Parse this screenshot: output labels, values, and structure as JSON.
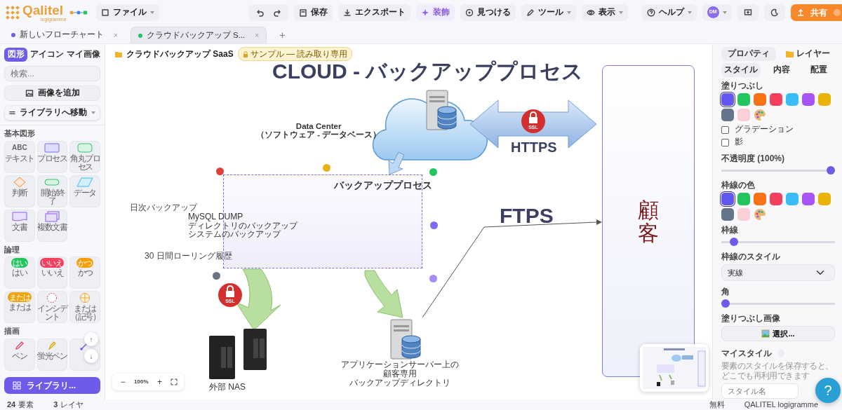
{
  "header": {
    "logo": "Qalitel",
    "logo_sub": "logigramme",
    "file_menu": "ファイル",
    "actions": [
      {
        "label": "保存",
        "active": false,
        "dropdown": false
      },
      {
        "label": "エクスポート",
        "active": false,
        "dropdown": false
      },
      {
        "label": "装飾",
        "active": true,
        "dropdown": false
      },
      {
        "label": "見つける",
        "active": false,
        "dropdown": false
      },
      {
        "label": "ツール",
        "active": false,
        "dropdown": true
      },
      {
        "label": "表示",
        "active": false,
        "dropdown": true
      },
      {
        "label": "ヘルプ",
        "active": false,
        "dropdown": true
      }
    ],
    "avatar": "DM",
    "share": "共有"
  },
  "tabs": [
    {
      "label": "新しいフローチャート",
      "color": "#6c5ce7",
      "selected": false,
      "close": "×"
    },
    {
      "label": "クラウドバックアップ S...",
      "color": "#22c55e",
      "selected": true,
      "close": "×"
    }
  ],
  "new_tab": "+",
  "library": {
    "tabs": [
      {
        "label": "図形",
        "selected": true
      },
      {
        "label": "アイコン",
        "selected": false
      },
      {
        "label": "マイ画像",
        "selected": false
      }
    ],
    "search_placeholder": "検索...",
    "add_image": "画像を追加",
    "goto_library": "ライブラリへ移動",
    "sections": [
      {
        "title": "基本図形",
        "items": [
          {
            "kind": "text",
            "glyph": "ABC",
            "label": "テキスト"
          },
          {
            "kind": "process",
            "label": "プロセス"
          },
          {
            "kind": "rounded",
            "label": "角丸プロセス"
          },
          {
            "kind": "decision",
            "label": "判断"
          },
          {
            "kind": "terminal",
            "label": "開始/終了"
          },
          {
            "kind": "data",
            "label": "データ"
          },
          {
            "kind": "document",
            "label": "文書"
          },
          {
            "kind": "multidoc",
            "label": "複数文書"
          }
        ]
      },
      {
        "title": "論理",
        "items": [
          {
            "kind": "pill",
            "color": "#22c55e",
            "badge": "はい",
            "label": "はい"
          },
          {
            "kind": "pill",
            "color": "#f43f5e",
            "badge": "いいえ",
            "label": "いいえ"
          },
          {
            "kind": "pill",
            "color": "#f59e0b",
            "badge": "かつ",
            "label": "かつ"
          },
          {
            "kind": "pill",
            "color": "#f0a30a",
            "badge": "または",
            "label": "または"
          },
          {
            "kind": "dashed",
            "label": "インシデント"
          },
          {
            "kind": "cross",
            "label": "または（記号）"
          }
        ]
      },
      {
        "title": "描画",
        "items": [
          {
            "kind": "pen",
            "label": "ペン"
          },
          {
            "kind": "highlighter",
            "label": "蛍光ペン"
          },
          {
            "kind": "line"
          }
        ]
      }
    ],
    "scroll": [
      "↑",
      "↓"
    ],
    "library_button": "ライブラリ..."
  },
  "diagram": {
    "breadcrumb": "クラウドバックアップ SaaS",
    "badge": "サンプル — 読み取り専用",
    "title": "CLOUD - バックアッププロセス",
    "data_center": [
      "Data Center",
      "（ソフトウェア - データベース）"
    ],
    "https": "HTTPS",
    "ssl": [
      "SSL",
      "SSL"
    ],
    "process": "バックアッププロセス",
    "daily": "日次バックアップ",
    "tasks": [
      "MySQL DUMP",
      "ディレクトリのバックアップ",
      "システムのバックアップ"
    ],
    "retention": "30 日間ローリング履歴",
    "ftps": "FTPS",
    "customer": "顧客",
    "nas": "外部 NAS",
    "app_server": [
      "アプリケーションサーバー上の",
      "顧客専用",
      "バックアップディレクトリ"
    ],
    "zoom": {
      "out": "−",
      "level": "100%",
      "in": "+"
    }
  },
  "properties": {
    "tabs": [
      {
        "label": "プロパティ",
        "selected": true
      },
      {
        "label": "レイヤー",
        "selected": false
      }
    ],
    "subtabs": [
      {
        "label": "スタイル",
        "selected": true
      },
      {
        "label": "内容",
        "selected": false
      },
      {
        "label": "配置",
        "selected": false
      }
    ],
    "fill": {
      "label": "塗りつぶし",
      "swatches": [
        {
          "color": "#6257f0",
          "selected": true
        },
        {
          "color": "#22c55e",
          "selected": false
        },
        {
          "color": "#f97316",
          "selected": false
        },
        {
          "color": "#f43f5e",
          "selected": false
        },
        {
          "color": "#38bdf8",
          "selected": false
        },
        {
          "color": "#a855f7",
          "selected": false
        },
        {
          "color": "#eab308",
          "selected": false
        },
        {
          "color": "#64748b",
          "selected": false
        },
        {
          "color": "#fbcfd6",
          "selected": false
        }
      ]
    },
    "options": [
      {
        "label": "グラデーション",
        "checked": false
      },
      {
        "label": "影",
        "checked": false
      }
    ],
    "opacity": {
      "label": "不透明度 (100%)",
      "level": 1
    },
    "stroke": {
      "label": "枠線の色",
      "swatches": [
        {
          "color": "#6257f0",
          "selected": true
        },
        {
          "color": "#22c55e",
          "selected": false
        },
        {
          "color": "#f97316",
          "selected": false
        },
        {
          "color": "#f43f5e",
          "selected": false
        },
        {
          "color": "#38bdf8",
          "selected": false
        },
        {
          "color": "#a855f7",
          "selected": false
        },
        {
          "color": "#eab308",
          "selected": false
        },
        {
          "color": "#64748b",
          "selected": false
        },
        {
          "color": "#fbcfd6",
          "selected": false
        }
      ]
    },
    "stroke_width": {
      "label": "枠線",
      "level": 0.08
    },
    "stroke_style": {
      "label": "枠線のスタイル",
      "value": "実線"
    },
    "corner": {
      "label": "角",
      "level": 0
    },
    "fill_image": {
      "label": "塗りつぶし画像",
      "button": "選択..."
    },
    "my_styles": {
      "label": "マイスタイル",
      "hint": "要素のスタイルを保存すると、どこでも再利用できます",
      "placeholder": "スタイル名"
    },
    "help": "?"
  },
  "status": {
    "elements_count": "24",
    "elements_label": "要素",
    "layers_count": "3",
    "layers_label": "レイヤ",
    "plan": "無料",
    "brand": "QALITEL logigramme"
  }
}
